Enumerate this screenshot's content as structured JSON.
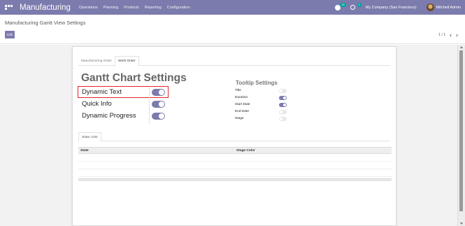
{
  "navbar": {
    "brand": "Manufacturing",
    "menu": [
      "Operations",
      "Planning",
      "Products",
      "Reporting",
      "Configuration"
    ],
    "chat_badge": "29",
    "activity_badge": "1",
    "company": "My Company (San Francisco)",
    "user": "Mitchell Admin",
    "bg_color": "#7c7bad"
  },
  "control": {
    "breadcrumb": "Manufacturing Gantt View Settings",
    "edit_label": "Edit",
    "pager": "1 / 1",
    "prev_icon": "‹",
    "next_icon": "›"
  },
  "form": {
    "tabs": [
      {
        "label": "Manufacturing Order",
        "active": false
      },
      {
        "label": "Work Order",
        "active": true
      }
    ],
    "title": "Gantt Chart Settings",
    "settings": [
      {
        "label": "Dynamic Text",
        "on": true
      },
      {
        "label": "Quick Info",
        "on": true
      },
      {
        "label": "Dynamic Progress",
        "on": true
      }
    ],
    "tooltip_title": "Tooltip Settings",
    "tooltip": [
      {
        "label": "Title",
        "on": false
      },
      {
        "label": "Duration",
        "on": true
      },
      {
        "label": "Start Date",
        "on": true
      },
      {
        "label": "End Date",
        "on": false
      },
      {
        "label": "Stage",
        "on": false
      }
    ],
    "subtab": "State color",
    "table": {
      "columns": [
        "State",
        "Stage Color"
      ],
      "rows": 3
    }
  }
}
